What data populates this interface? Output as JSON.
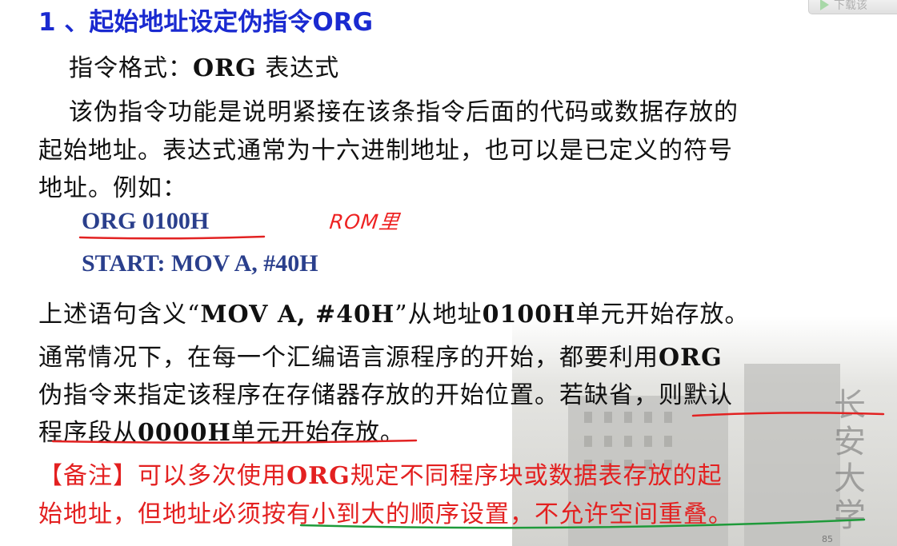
{
  "download_button": {
    "label": "下载该"
  },
  "title": "1 、起始地址设定伪指令ORG",
  "format_line": {
    "prefix": "指令格式：",
    "keyword": "ORG",
    "suffix": " 表达式"
  },
  "desc_lines": [
    "该伪指令功能是说明紧接在该条指令后面的代码或数据存放的",
    "起始地址。表达式通常为十六进制地址，也可以是已定义的符号",
    "地址。例如："
  ],
  "code": {
    "line1": "ORG  0100H",
    "line2": "START: MOV A, #40H"
  },
  "hand_note": "ROM里",
  "meaning_line": {
    "p1": "上述语句含义“",
    "code": "MOV A, #40H",
    "p2": "”从地址",
    "addr": "0100H",
    "p3": "单元开始存放。"
  },
  "usual_lines": {
    "l1_text": "通常情况下，在每一个汇编语言源程序的开始，都要利用",
    "l1_kw": "ORG",
    "l2": "伪指令来指定该程序在存储器存放的开始位置。若缺省，则默认",
    "l3_p1": "程序段从",
    "l3_addr": "0000H",
    "l3_p2": "单元开始存放。"
  },
  "note_lines": {
    "l1_p1": "【备注】可以多次使用",
    "l1_kw": "ORG",
    "l1_p2": "规定不同程序块或数据表存放的起",
    "l2": "始地址，但地址必须按有小到大的顺序设置，不允许空间重叠。"
  },
  "background": {
    "calligraphy": "长安大学",
    "page_number": "85"
  },
  "colors": {
    "title": "#1a2ad0",
    "code": "#2a3f8c",
    "note": "#e32020",
    "red_ink": "#e22222",
    "green_ink": "#1e9a3a"
  }
}
